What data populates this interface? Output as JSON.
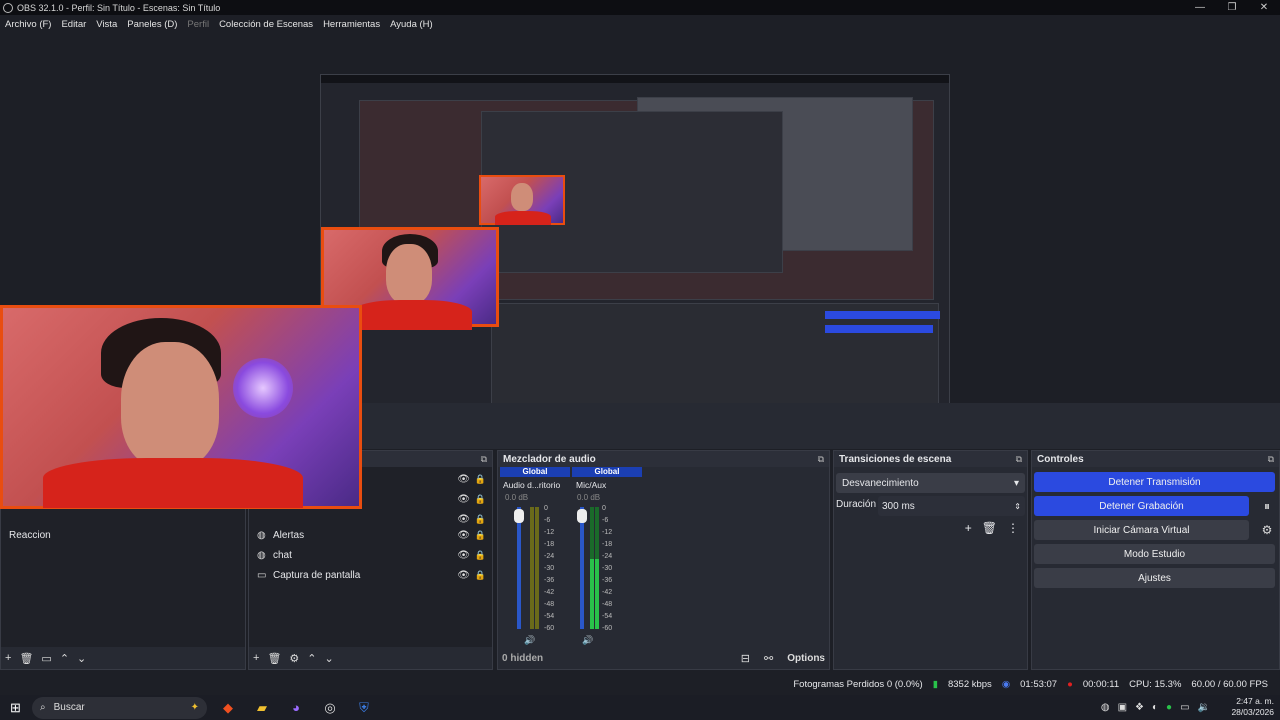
{
  "titlebar": {
    "title": "OBS 32.1.0 - Perfil: Sin Título - Escenas: Sin Título"
  },
  "menu": [
    "Archivo (F)",
    "Editar",
    "Vista",
    "Paneles (D)",
    "Perfil",
    "Colección de Escenas",
    "Herramientas",
    "Ayuda (H)"
  ],
  "scenes": {
    "items": [
      "Reaccion"
    ]
  },
  "sources": {
    "items": [
      {
        "icon": "globe-icon",
        "label": "Alertas"
      },
      {
        "icon": "globe-icon",
        "label": "chat"
      },
      {
        "icon": "monitor-icon",
        "label": "Captura de pantalla"
      }
    ]
  },
  "mixer": {
    "title": "Mezclador de audio",
    "channels": [
      {
        "global": "Global",
        "name": "Audio d...ritorio",
        "level": "0.0 dB"
      },
      {
        "global": "Global",
        "name": "Mic/Aux",
        "level": "0.0 dB"
      }
    ],
    "ticks": [
      "0",
      "-6",
      "-12",
      "-18",
      "-24",
      "-30",
      "-36",
      "-42",
      "-48",
      "-54",
      "-60"
    ],
    "hidden": "0 hidden",
    "options": "Options"
  },
  "transitions": {
    "title": "Transiciones de escena",
    "selected": "Desvanecimiento",
    "duration_label": "Duración",
    "duration_value": "300 ms"
  },
  "controls": {
    "title": "Controles",
    "stop_stream": "Detener Transmisión",
    "stop_record": "Detener Grabación",
    "virtual_cam": "Iniciar Cámara Virtual",
    "studio": "Modo Estudio",
    "settings": "Ajustes"
  },
  "status": {
    "dropped": "Fotogramas Perdidos 0 (0.0%)",
    "bitrate": "8352 kbps",
    "stream_time": "01:53:07",
    "rec_time": "00:00:11",
    "cpu": "CPU: 15.3%",
    "fps": "60.00 / 60.00 FPS"
  },
  "taskbar": {
    "search": "Buscar",
    "time": "2:47 a. m.",
    "date": "28/03/2026"
  }
}
